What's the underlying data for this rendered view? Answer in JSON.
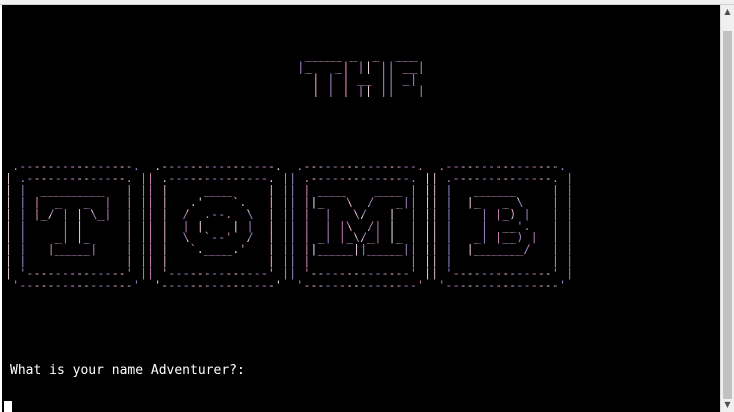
{
  "terminal": {
    "title_art": "   _____ _  _  ___ \n  |_   _| || || __|\n    | | | __ || _| \n    |_| |_||_||___|",
    "tomb_art": " .----------------.  .----------------.  .----------------.  .----------------. \n| .--------------. || .--------------. || .--------------. || .--------------. |\n| |  _________   | || |     ____     | || | ____    ____ | || |   ______     | |\n| | |  _   _  |  | || |   .'    `.   | || ||_   \\  /   _|| || |  |_   _ \\    | |\n| | |_/ | | \\_|  | || |  /  .--.  \\  | || |  |   \\/   |  | || |    | |_) |   | |\n| |     | |      | || |  | |    | |  | || |  | |\\  /| |  | || |    |  __'.   | |\n| |    _| |_     | || |  \\  `--'  /  | || | _| |_\\/_| |_ | || |   _| |__) |  | |\n| |   |_____|    | || |   `.____.'   | || ||_____||_____|| || |  |_______/   | |\n| |              | || |              | || |              | || |              | |\n| '--------------' || '--------------' || '--------------' || '--------------' |\n '----------------'  '----------------'  '----------------'  '----------------' ",
    "prompt": "What is your name Adventurer?:",
    "input_value": ""
  },
  "colors": {
    "background": "#000000",
    "text": "#ffffff",
    "art_blue": "#8a8ad8",
    "art_pink": "#d07aa8"
  }
}
